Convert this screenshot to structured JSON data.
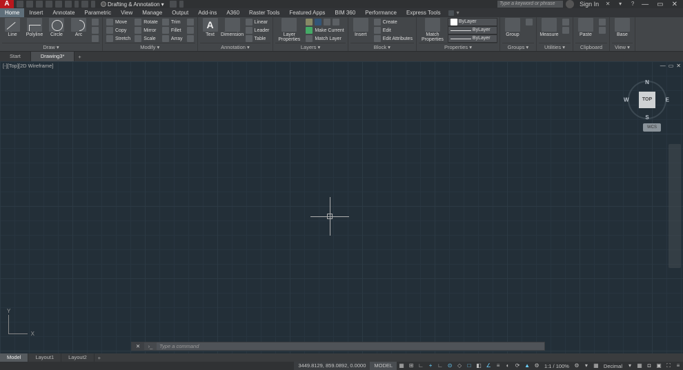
{
  "app": {
    "logo": "A",
    "workspace": "Drafting & Annotation",
    "search_placeholder": "Type a keyword or phrase",
    "signin": "Sign In"
  },
  "win": {
    "min": "—",
    "max": "▭",
    "close": "✕"
  },
  "menu": [
    "Home",
    "Insert",
    "Annotate",
    "Parametric",
    "View",
    "Manage",
    "Output",
    "Add-ins",
    "A360",
    "Raster Tools",
    "Featured Apps",
    "BIM 360",
    "Performance",
    "Express Tools"
  ],
  "ribbon": {
    "draw": {
      "title": "Draw ▾",
      "line": "Line",
      "polyline": "Polyline",
      "circle": "Circle",
      "arc": "Arc"
    },
    "modify": {
      "title": "Modify ▾",
      "move": "Move",
      "copy": "Copy",
      "stretch": "Stretch",
      "rotate": "Rotate",
      "mirror": "Mirror",
      "scale": "Scale",
      "trim": "Trim",
      "fillet": "Fillet",
      "array": "Array"
    },
    "annotation": {
      "title": "Annotation ▾",
      "text": "Text",
      "dim": "Dimension",
      "linear": "Linear",
      "leader": "Leader",
      "table": "Table"
    },
    "layers": {
      "title": "Layers ▾",
      "props": "Layer Properties",
      "make": "Make Current",
      "match": "Match Layer"
    },
    "block": {
      "title": "Block ▾",
      "insert": "Insert",
      "create": "Create",
      "edit": "Edit",
      "editattr": "Edit Attributes"
    },
    "props": {
      "title": "Properties ▾",
      "match": "Match Properties",
      "bylayer": "ByLayer"
    },
    "groups": {
      "title": "Groups ▾",
      "group": "Group"
    },
    "utils": {
      "title": "Utilities ▾",
      "measure": "Measure"
    },
    "clip": {
      "title": "Clipboard",
      "paste": "Paste"
    },
    "view": {
      "title": "View ▾",
      "base": "Base"
    }
  },
  "filetabs": {
    "start": "Start",
    "drawing": "Drawing3*"
  },
  "viewport": {
    "label": "[-][Top][2D Wireframe]",
    "wcs": "WCS",
    "cube": {
      "top": "TOP",
      "n": "N",
      "s": "S",
      "e": "E",
      "w": "W"
    },
    "ucs": {
      "y": "Y",
      "x": "X"
    }
  },
  "viewctrl": {
    "min": "—",
    "max": "▭",
    "close": "✕"
  },
  "command": {
    "close": "✕",
    "arrow": "›_",
    "placeholder": "Type a command"
  },
  "layouttabs": [
    "Model",
    "Layout1",
    "Layout2"
  ],
  "status": {
    "coords": "3449.8129, 859.0892, 0.0000",
    "mode": "MODEL",
    "scale": "1:1 / 100%",
    "units": "Decimal"
  }
}
